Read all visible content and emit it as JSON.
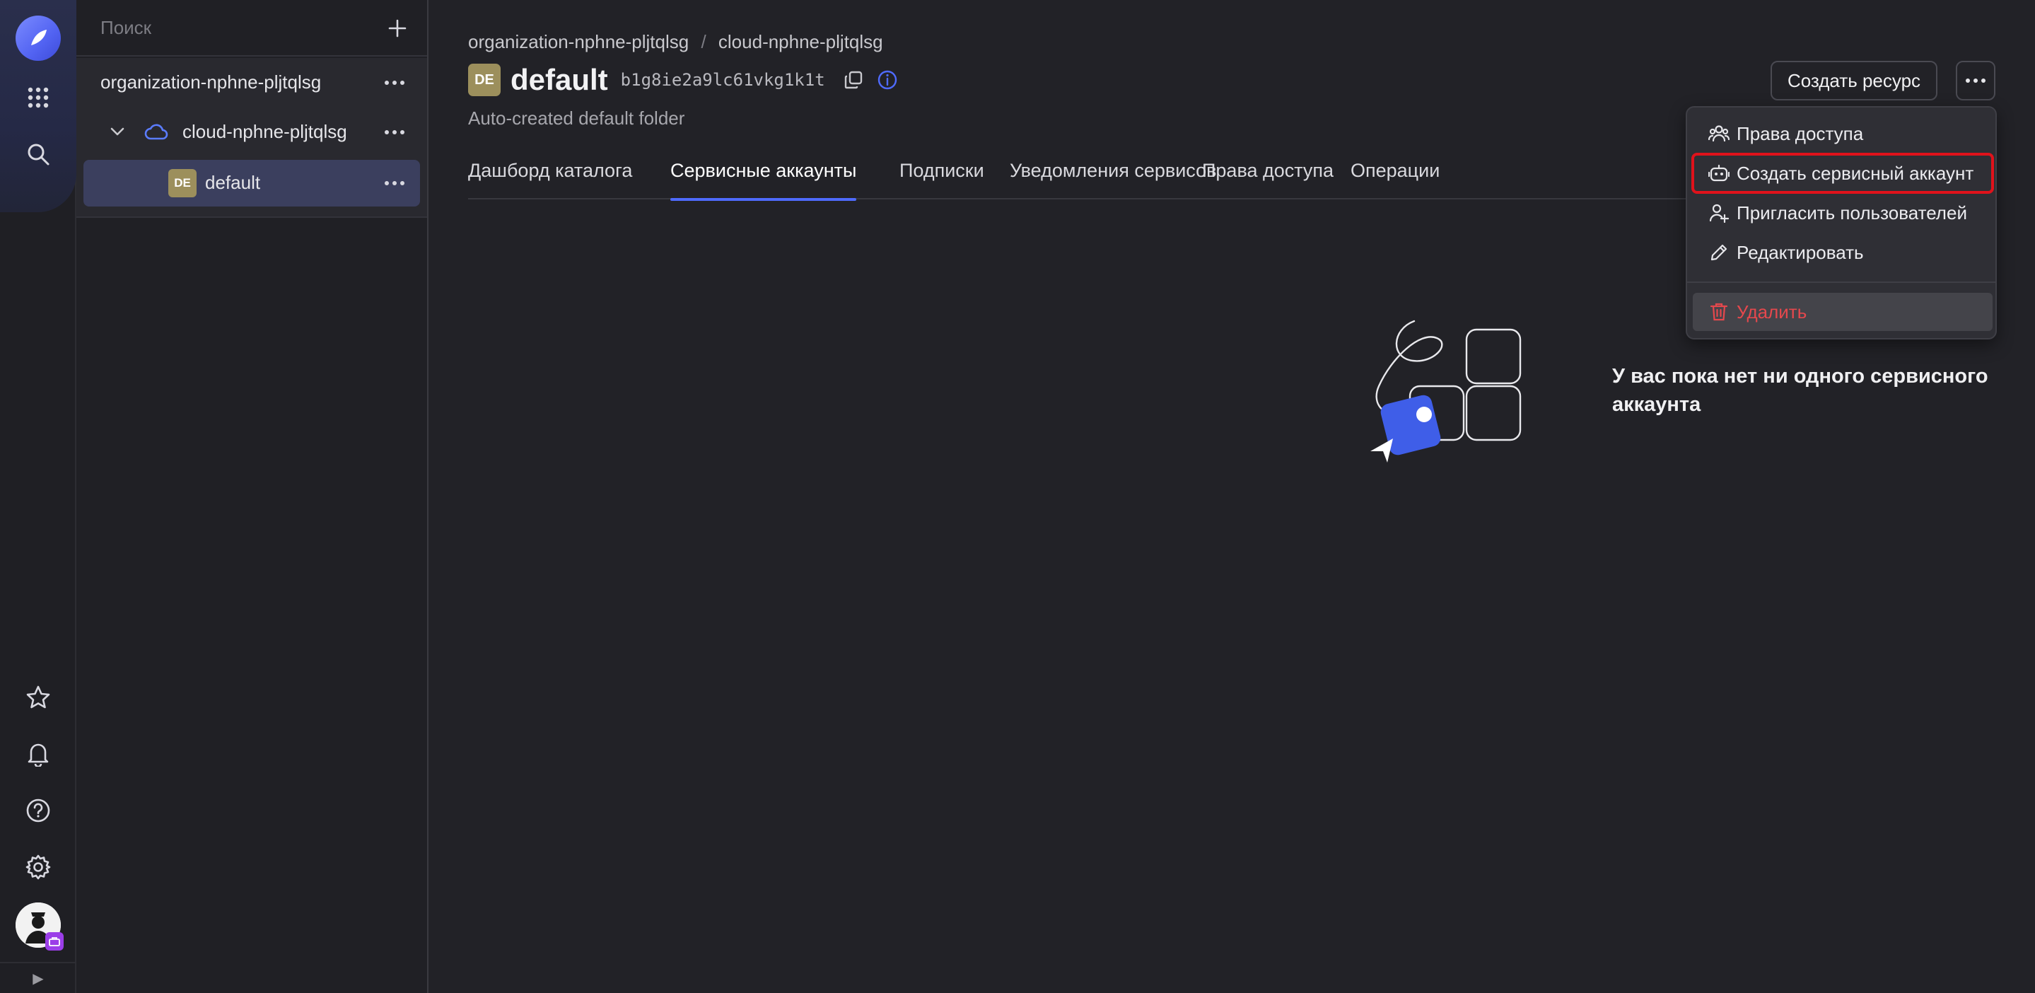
{
  "rail": {
    "icons": [
      "logo-icon",
      "apps-grid-icon",
      "search-icon",
      "star-icon",
      "bell-icon",
      "help-icon",
      "gear-icon"
    ],
    "collapse_glyph": "▶"
  },
  "tree": {
    "search_placeholder": "Поиск",
    "organization": "organization-nphne-pljtqlsg",
    "cloud": "cloud-nphne-pljtqlsg",
    "folder": "default",
    "folder_badge": "DE"
  },
  "header": {
    "breadcrumb": [
      "organization-nphne-pljtqlsg",
      "cloud-nphne-pljtqlsg"
    ],
    "breadcrumb_sep": "/",
    "badge": "DE",
    "title": "default",
    "id": "b1g8ie2a9lc61vkg1k1t",
    "subtitle": "Auto-created default folder",
    "create_resource": "Создать ресурс"
  },
  "tabs": [
    {
      "label": "Дашборд каталога"
    },
    {
      "label": "Сервисные аккаунты"
    },
    {
      "label": "Подписки"
    },
    {
      "label": "Уведомления сервисов"
    },
    {
      "label": "Права доступа"
    },
    {
      "label": "Операции"
    }
  ],
  "active_tab": "Сервисные аккаунты",
  "menu": {
    "items": [
      {
        "label": "Права доступа",
        "icon": "people-icon"
      },
      {
        "label": "Создать сервисный аккаунт",
        "icon": "robot-icon"
      },
      {
        "label": "Пригласить пользователей",
        "icon": "person-add-icon"
      },
      {
        "label": "Редактировать",
        "icon": "pencil-icon"
      },
      {
        "label": "Удалить",
        "icon": "trash-icon"
      }
    ]
  },
  "empty_state": {
    "message": "У вас пока нет ни одного сервисного аккаунта"
  },
  "colors": {
    "accent": "#4f6bff",
    "danger": "#e5484d",
    "highlight_outline": "#e0121b",
    "folder_badge": "#9c8f5c"
  }
}
